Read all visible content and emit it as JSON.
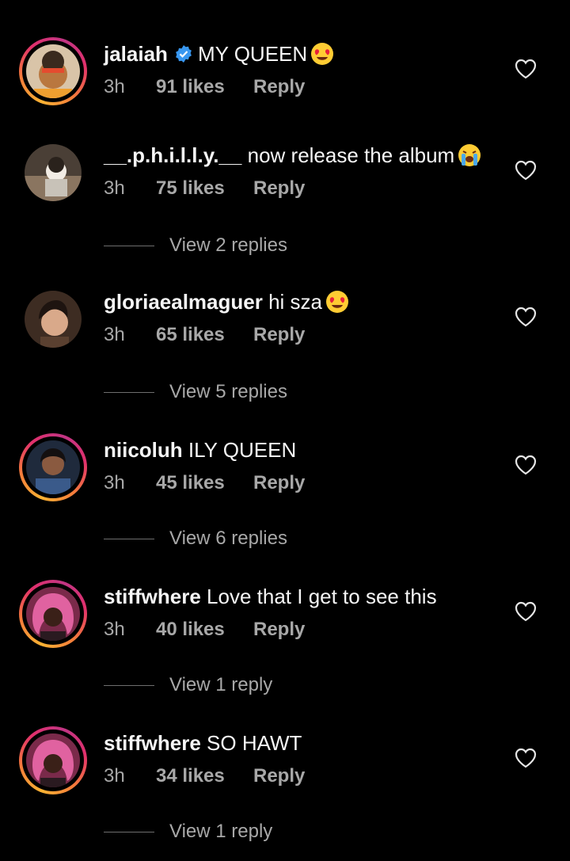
{
  "comments": [
    {
      "username": "jalaiah",
      "verified": true,
      "text": "MY QUEEN",
      "emoji": "heart-eyes",
      "time": "3h",
      "likes": "91 likes",
      "reply": "Reply",
      "ring": true,
      "avatar_color": "#c08a55"
    },
    {
      "username": "__.p.h.i.l.l.y.__",
      "verified": false,
      "text": "now release the album",
      "emoji": "crying",
      "time": "3h",
      "likes": "75 likes",
      "reply": "Reply",
      "ring": false,
      "avatar_color": "#6b5a4a"
    },
    {
      "username": "gloriaealmaguer",
      "verified": false,
      "text": "hi sza",
      "emoji": "heart-eyes",
      "time": "3h",
      "likes": "65 likes",
      "reply": "Reply",
      "ring": false,
      "avatar_color": "#5a4435"
    },
    {
      "username": "niicoluh",
      "verified": false,
      "text": "ILY QUEEN",
      "emoji": "",
      "time": "3h",
      "likes": "45 likes",
      "reply": "Reply",
      "ring": true,
      "avatar_color": "#2f3e57"
    },
    {
      "username": "stiffwhere",
      "verified": false,
      "text": "Love that I get to see this",
      "emoji": "",
      "time": "3h",
      "likes": "40 likes",
      "reply": "Reply",
      "ring": true,
      "avatar_color": "#c95a8f"
    },
    {
      "username": "stiffwhere",
      "verified": false,
      "text": "SO HAWT",
      "emoji": "",
      "time": "3h",
      "likes": "34 likes",
      "reply": "Reply",
      "ring": true,
      "avatar_color": "#c95a8f"
    }
  ],
  "view_replies": [
    "View 2 replies",
    "View 5 replies",
    "View 6 replies",
    "View 1 reply",
    "View 1 reply"
  ],
  "colors": {
    "background": "#000000",
    "text": "#f5f5f5",
    "secondary": "#a8a8a8",
    "verified": "#3897f0"
  }
}
